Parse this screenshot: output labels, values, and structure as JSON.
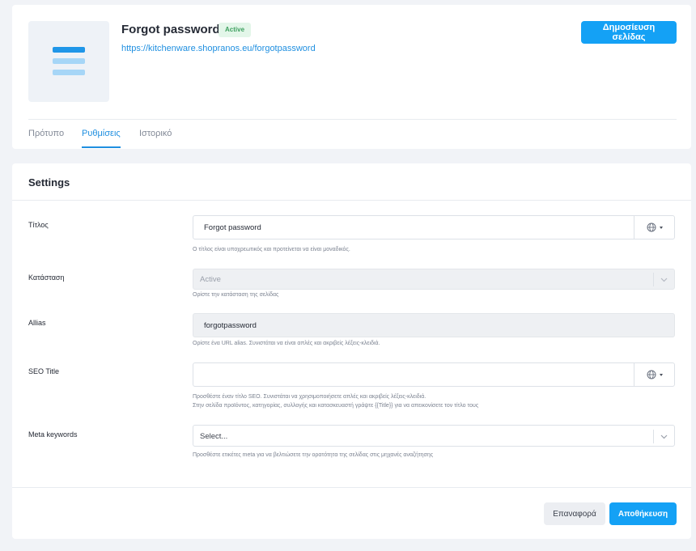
{
  "header": {
    "title": "Forgot password",
    "status_badge": "Active",
    "url": "https://kitchenware.shopranos.eu/forgotpassword",
    "publish_label": "Δημοσίευση σελίδας"
  },
  "tabs": [
    {
      "label": "Πρότυπο",
      "active": false
    },
    {
      "label": "Ρυθμίσεις",
      "active": true
    },
    {
      "label": "Ιστορικό",
      "active": false
    }
  ],
  "settings": {
    "title": "Settings",
    "fields": {
      "title": {
        "label": "Τίτλος",
        "value": "Forgot password",
        "help": "Ο τίτλος είναι υποχρεωτικός και προτείνεται να είναι μοναδικός."
      },
      "status": {
        "label": "Κατάσταση",
        "value": "Active",
        "help": "Ορίστε την κατάσταση της σελίδας"
      },
      "alias": {
        "label": "Allias",
        "value": "forgotpassword",
        "help": "Ορίστε ένα URL alias. Συνιστάται να είναι απλές και ακριβείς λέξεις-κλειδιά."
      },
      "seo_title": {
        "label": "SEO Title",
        "value": "",
        "help_line1": "Προσθέστε έναν τίτλο SEO. Συνιστάται να χρησιμοποιήσετε απλές και ακριβείς λέξεις-κλειδιά.",
        "help_line2": "Στην σελίδα προϊόντος, κατηγορίας, συλλογής και κατασκευαστή γράψτε {{Title}} για να απεικονίσετε τον τίτλο τους"
      },
      "meta_keywords": {
        "label": "Meta keywords",
        "placeholder": "Select...",
        "help": "Προσθέστε ετικέτες meta για να βελτιώσετε την ορατότητα της σελίδας στις μηχανές αναζήτησης"
      }
    },
    "reset_label": "Επαναφορά",
    "save_label": "Αποθήκευση"
  },
  "icons": {
    "globe": "globe-icon",
    "caret": "caret-down-icon",
    "chevron": "chevron-down-icon",
    "thumbnail": "page-thumbnail-icon"
  },
  "colors": {
    "accent": "#14a1f5",
    "link": "#1f8fe0",
    "badge_bg": "#e3f6e9",
    "badge_text": "#3fa060"
  }
}
